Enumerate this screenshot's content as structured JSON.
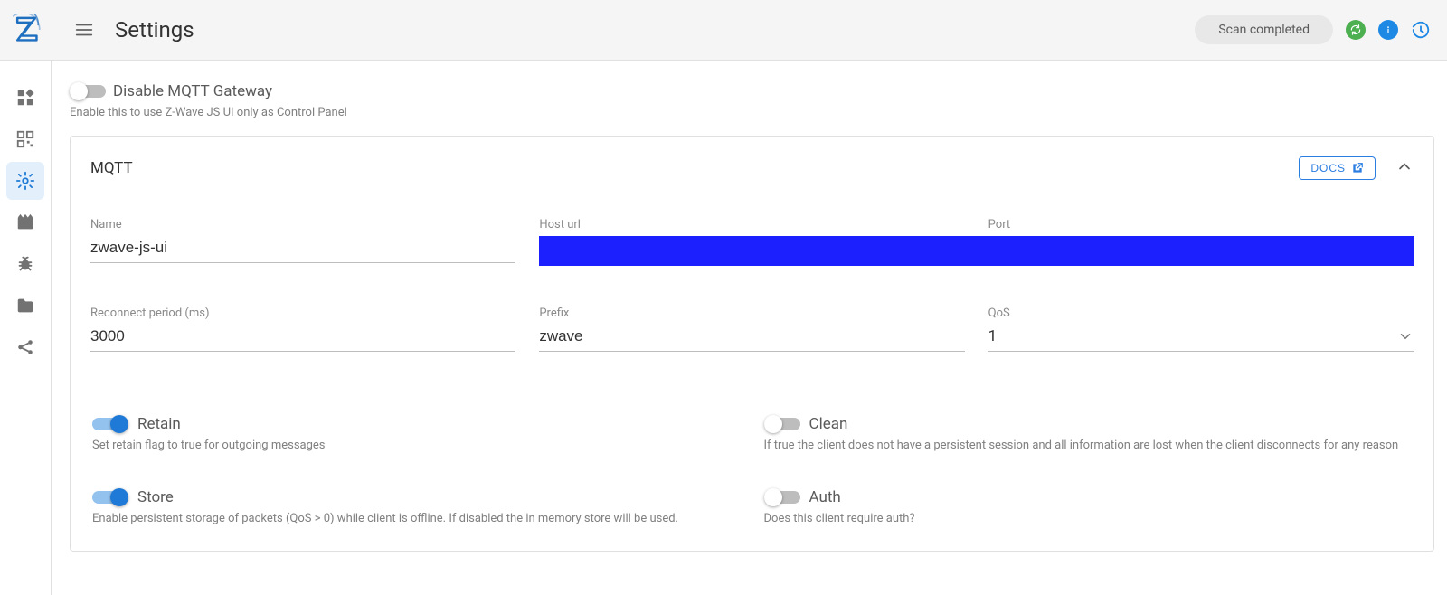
{
  "header": {
    "title": "Settings",
    "scan_status": "Scan completed"
  },
  "toggle_gateway": {
    "label": "Disable MQTT Gateway",
    "hint": "Enable this to use Z-Wave JS UI only as Control Panel",
    "enabled": false
  },
  "mqtt_panel": {
    "title": "MQTT",
    "docs_label": "DOCS",
    "fields": {
      "name": {
        "label": "Name",
        "value": "zwave-js-ui"
      },
      "host": {
        "label": "Host url",
        "value": ""
      },
      "port": {
        "label": "Port",
        "value": ""
      },
      "reconnect": {
        "label": "Reconnect period (ms)",
        "value": "3000"
      },
      "prefix": {
        "label": "Prefix",
        "value": "zwave"
      },
      "qos": {
        "label": "QoS",
        "value": "1"
      }
    },
    "toggles": {
      "retain": {
        "label": "Retain",
        "hint": "Set retain flag to true for outgoing messages",
        "enabled": true
      },
      "clean": {
        "label": "Clean",
        "hint": "If true the client does not have a persistent session and all information are lost when the client disconnects for any reason",
        "enabled": false
      },
      "store": {
        "label": "Store",
        "hint": "Enable persistent storage of packets (QoS > 0) while client is offline. If disabled the in memory store will be used.",
        "enabled": true
      },
      "auth": {
        "label": "Auth",
        "hint": "Does this client require auth?",
        "enabled": false
      }
    }
  }
}
